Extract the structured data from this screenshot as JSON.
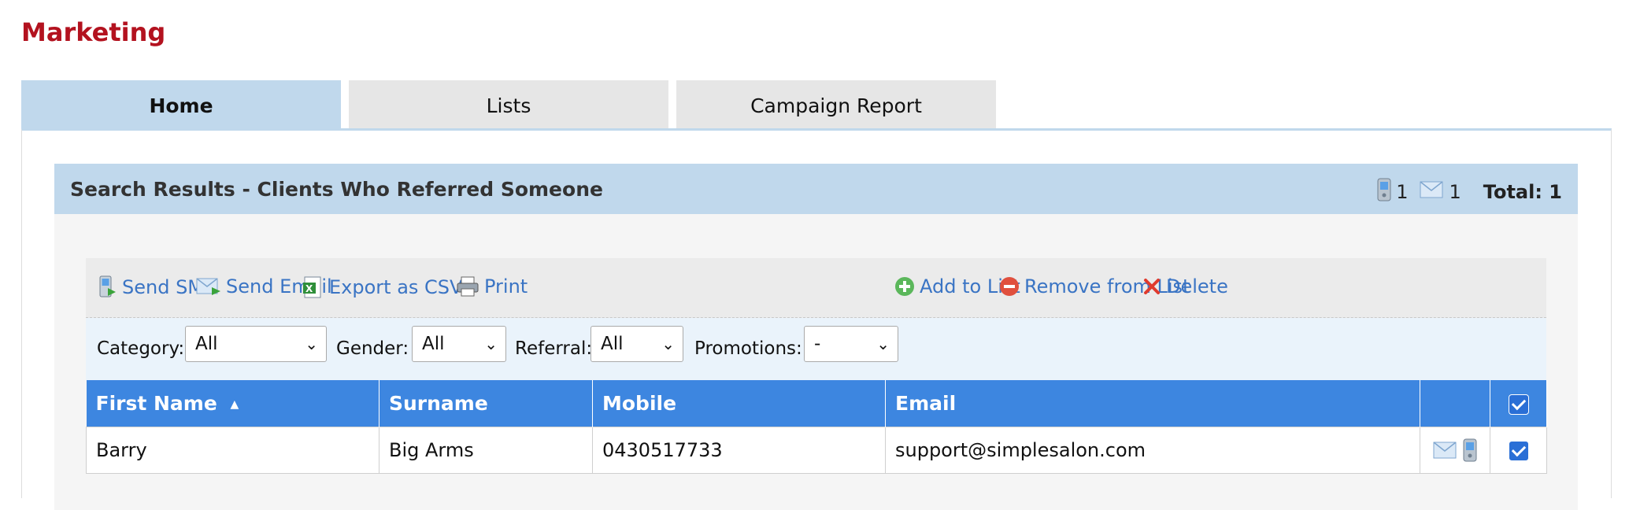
{
  "page": {
    "title": "Marketing"
  },
  "tabs": [
    {
      "label": "Home",
      "active": true
    },
    {
      "label": "Lists",
      "active": false
    },
    {
      "label": "Campaign Report",
      "active": false
    }
  ],
  "panel": {
    "title": "Search Results - Clients Who Referred Someone",
    "sms_count": "1",
    "email_count": "1",
    "total": "Total: 1"
  },
  "toolbar": {
    "send_sms": "Send SMS",
    "send_email": "Send Email",
    "export_csv": "Export as CSV",
    "print": "Print",
    "add_to_list": "Add to List",
    "remove_from_list": "Remove from List",
    "delete": "Delete"
  },
  "filters": {
    "category": {
      "label": "Category:",
      "value": "All"
    },
    "gender": {
      "label": "Gender:",
      "value": "All"
    },
    "referral": {
      "label": "Referral:",
      "value": "All"
    },
    "promotions": {
      "label": "Promotions:",
      "value": "-"
    }
  },
  "table": {
    "columns": [
      "First Name",
      "Surname",
      "Mobile",
      "Email"
    ],
    "sort_column": "First Name",
    "sort_direction": "ascending",
    "rows": [
      {
        "first_name": "Barry",
        "surname": "Big Arms",
        "mobile": "0430517733",
        "email": "support@simplesalon.com",
        "selected": true
      }
    ]
  },
  "colors": {
    "title_red": "#b3121f",
    "tab_active": "#c0d8ec",
    "header_blue": "#3d86e0",
    "link_blue": "#3a74c4"
  },
  "icons": [
    "sms-icon",
    "email-icon",
    "csv-icon",
    "print-icon",
    "add-icon",
    "remove-icon",
    "delete-icon",
    "mobile-phone-icon",
    "envelope-icon",
    "sort-asc-icon"
  ]
}
